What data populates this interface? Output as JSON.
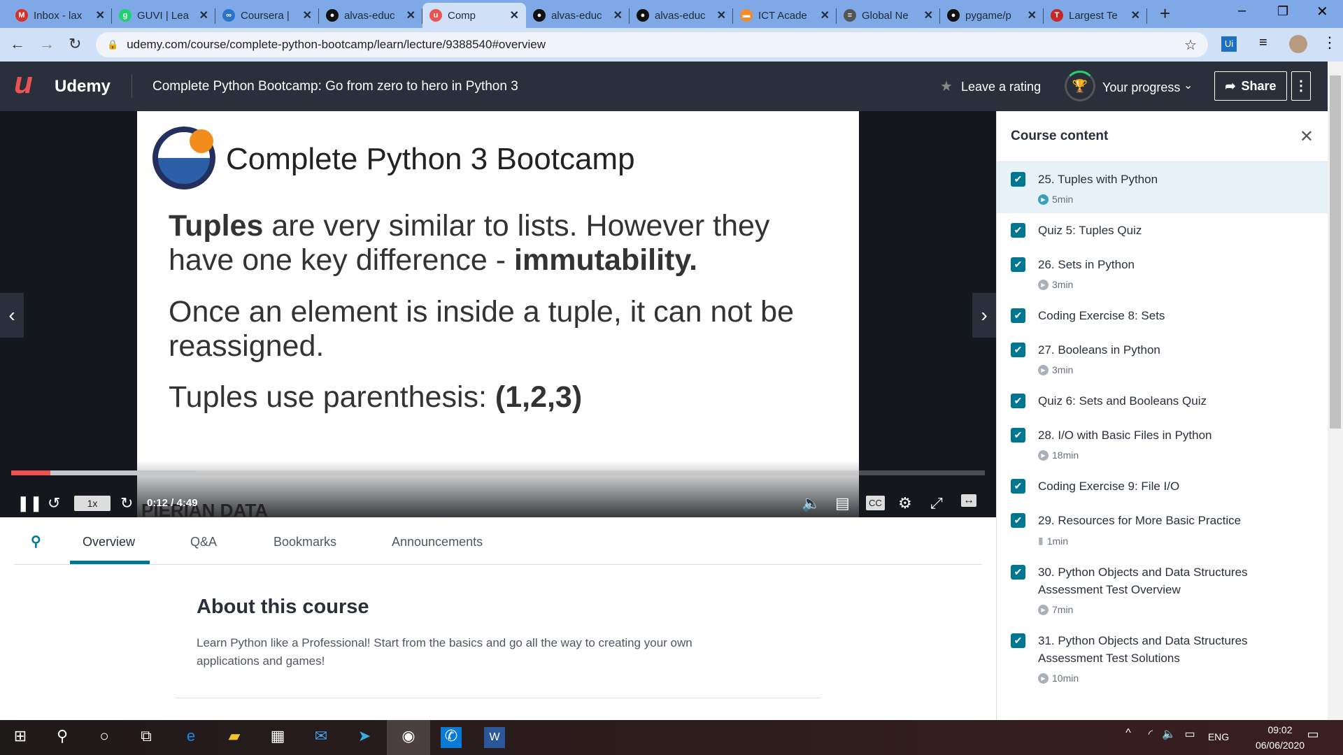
{
  "browser": {
    "tabs": [
      {
        "title": "Inbox - lax",
        "icon": "gmail-icon",
        "color": "#d93025",
        "glyph": "M"
      },
      {
        "title": "GUVI | Lea",
        "icon": "guvi-icon",
        "color": "#1fd16f",
        "glyph": "g"
      },
      {
        "title": "Coursera |",
        "icon": "coursera-icon",
        "color": "#2a73cc",
        "glyph": "∞"
      },
      {
        "title": "alvas-educ",
        "icon": "github-icon",
        "color": "#111",
        "glyph": "●"
      },
      {
        "title": "Comp",
        "icon": "udemy-icon",
        "color": "#ec5252",
        "glyph": "u",
        "active": true
      },
      {
        "title": "alvas-educ",
        "icon": "github-icon",
        "color": "#111",
        "glyph": "●"
      },
      {
        "title": "alvas-educ",
        "icon": "github-icon",
        "color": "#111",
        "glyph": "●"
      },
      {
        "title": "ICT Acade",
        "icon": "ict-icon",
        "color": "#f48a2a",
        "glyph": "▬"
      },
      {
        "title": "Global Ne",
        "icon": "cisco-icon",
        "color": "#555",
        "glyph": "≡"
      },
      {
        "title": "pygame/p",
        "icon": "github-icon",
        "color": "#111",
        "glyph": "●"
      },
      {
        "title": "Largest Te",
        "icon": "tg-icon",
        "color": "#c62828",
        "glyph": "T"
      }
    ],
    "url": "udemy.com/course/complete-python-bootcamp/learn/lecture/9388540#overview"
  },
  "header": {
    "brand": "Udemy",
    "course_title": "Complete Python Bootcamp: Go from zero to hero in Python 3",
    "rating": "Leave a rating",
    "progress": "Your progress",
    "share": "Share"
  },
  "slide": {
    "title": "Complete Python 3 Bootcamp",
    "p1_bold": "Tuples",
    "p1_a": " are very similar to lists. However they",
    "p1_b": "have one key difference - ",
    "p1_bold2": "immutability.",
    "p2_a": "Once an element is inside a tuple, it can not be",
    "p2_b": "reassigned.",
    "p3": "Tuples use parenthesis:  ",
    "p3_bold": "(1,2,3)",
    "watermark": "PIERIAN DATA"
  },
  "player": {
    "time": "0:12 / 4:49",
    "speed": "1x",
    "progress_fraction": 0.04,
    "buffered_fraction": 0.19,
    "cc": "CC"
  },
  "tabs": {
    "overview": "Overview",
    "qa": "Q&A",
    "bookmarks": "Bookmarks",
    "announcements": "Announcements"
  },
  "about": {
    "title": "About this course",
    "text": "Learn Python like a Professional! Start from the basics and go all the way to creating your own applications and games!"
  },
  "sidebar": {
    "title": "Course content",
    "items": [
      {
        "title": "25. Tuples with Python",
        "duration": "5min",
        "type": "video"
      },
      {
        "title": "Quiz 5: Tuples Quiz"
      },
      {
        "title": "26. Sets in Python",
        "duration": "3min",
        "type": "video"
      },
      {
        "title": "Coding Exercise 8: Sets"
      },
      {
        "title": "27. Booleans in Python",
        "duration": "3min",
        "type": "video"
      },
      {
        "title": "Quiz 6: Sets and Booleans Quiz"
      },
      {
        "title": "28. I/O with Basic Files in Python",
        "duration": "18min",
        "type": "video"
      },
      {
        "title": "Coding Exercise 9: File I/O"
      },
      {
        "title": "29. Resources for More Basic Practice",
        "duration": "1min",
        "type": "file"
      },
      {
        "title": "30. Python Objects and Data Structures Assessment Test Overview",
        "duration": "7min",
        "type": "video"
      },
      {
        "title": "31. Python Objects and Data Structures Assessment Test Solutions",
        "duration": "10min",
        "type": "video"
      }
    ]
  },
  "taskbar": {
    "lang": "ENG",
    "time": "09:02",
    "date": "06/06/2020"
  }
}
